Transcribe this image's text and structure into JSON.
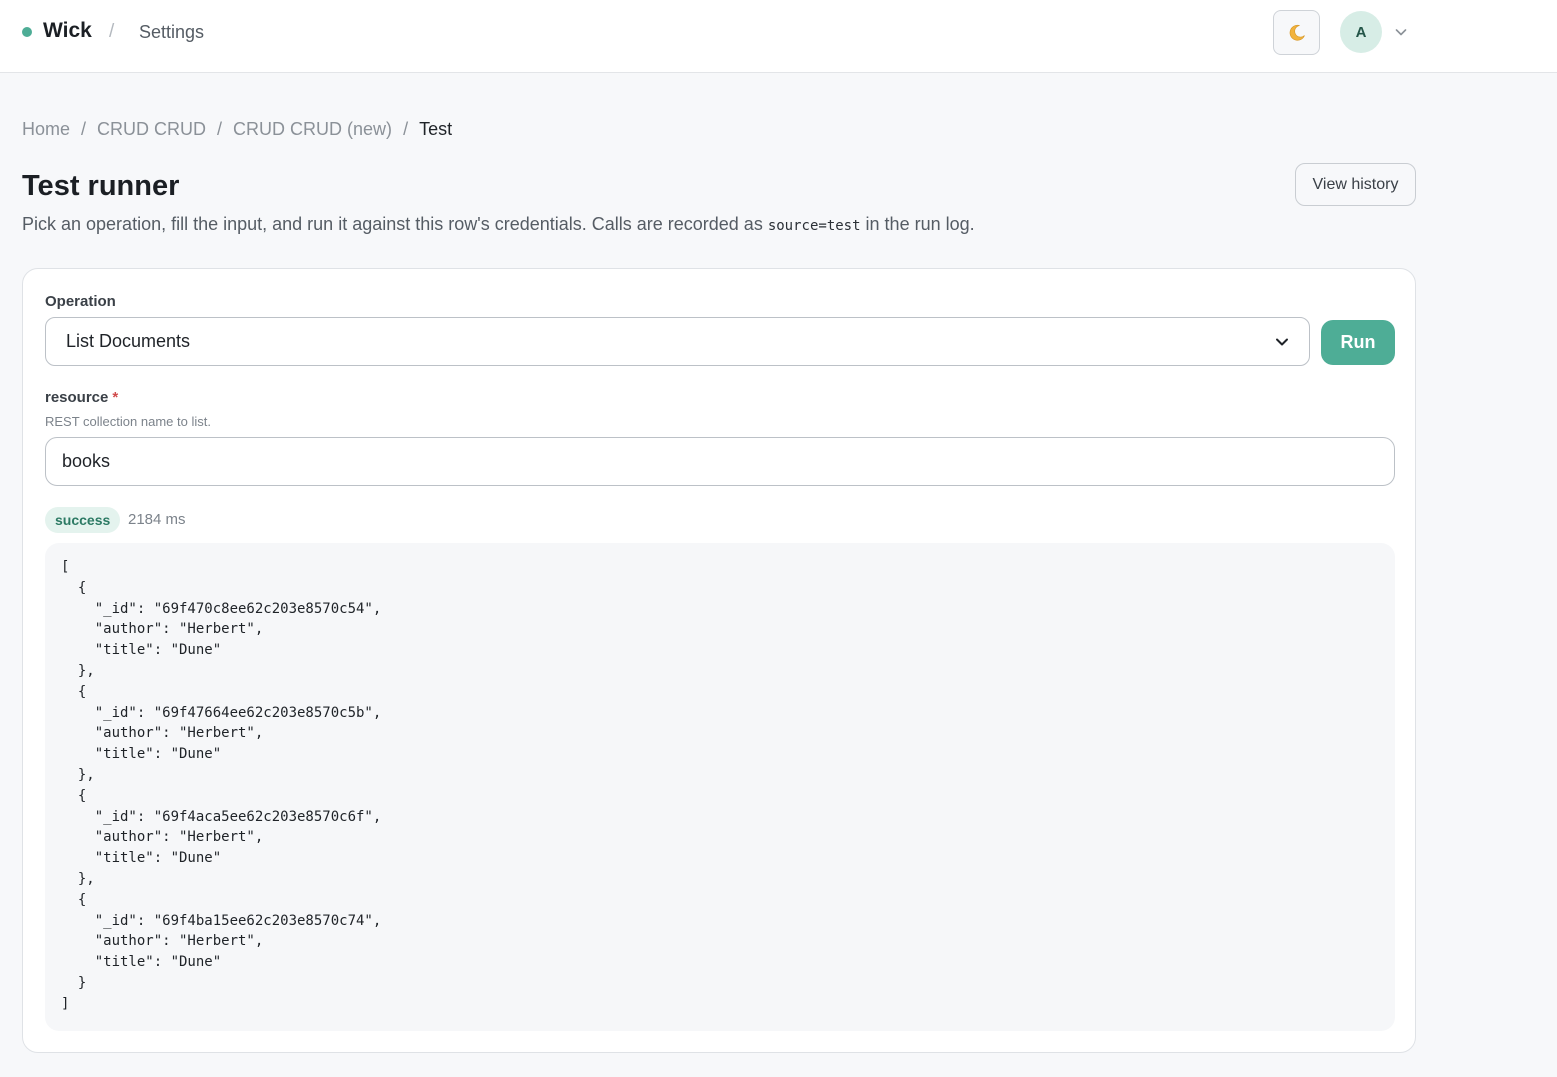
{
  "header": {
    "brand": "Wick",
    "separator": "/",
    "section": "Settings",
    "theme_icon": "moon-icon",
    "avatar_initial": "A"
  },
  "breadcrumb": {
    "items": [
      "Home",
      "CRUD CRUD",
      "CRUD CRUD (new)",
      "Test"
    ],
    "separator": "/"
  },
  "page": {
    "title": "Test runner",
    "subtitle_before": "Pick an operation, fill the input, and run it against this row's credentials. Calls are recorded as ",
    "subtitle_code": "source=test",
    "subtitle_after": " in the run log.",
    "view_history_label": "View history"
  },
  "form": {
    "operation_label": "Operation",
    "operation_value": "List Documents",
    "run_label": "Run",
    "resource_label": "resource",
    "resource_required_mark": "*",
    "resource_help": "REST collection name to list.",
    "resource_value": "books"
  },
  "result": {
    "status": "success",
    "duration": "2184 ms",
    "output": "[\n  {\n    \"_id\": \"69f470c8ee62c203e8570c54\",\n    \"author\": \"Herbert\",\n    \"title\": \"Dune\"\n  },\n  {\n    \"_id\": \"69f47664ee62c203e8570c5b\",\n    \"author\": \"Herbert\",\n    \"title\": \"Dune\"\n  },\n  {\n    \"_id\": \"69f4aca5ee62c203e8570c6f\",\n    \"author\": \"Herbert\",\n    \"title\": \"Dune\"\n  },\n  {\n    \"_id\": \"69f4ba15ee62c203e8570c74\",\n    \"author\": \"Herbert\",\n    \"title\": \"Dune\"\n  }\n]"
  },
  "colors": {
    "accent": "#4ead96",
    "success_bg": "#e4f3ee",
    "success_text": "#2c7a64",
    "required": "#d04b4b"
  }
}
